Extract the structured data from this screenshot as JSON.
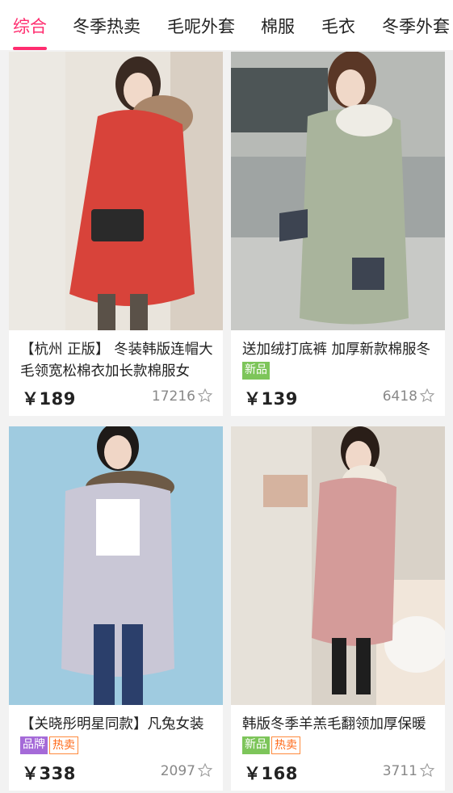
{
  "tabs": [
    {
      "label": "综合",
      "active": true
    },
    {
      "label": "冬季热卖",
      "active": false
    },
    {
      "label": "毛呢外套",
      "active": false
    },
    {
      "label": "棉服",
      "active": false
    },
    {
      "label": "毛衣",
      "active": false
    },
    {
      "label": "冬季外套",
      "active": false
    }
  ],
  "products": [
    {
      "title": "【杭州 正版】 冬装韩版连帽大毛领宽松棉衣加长款棉服女",
      "tags": [],
      "price": "￥189",
      "sales": "17216",
      "photo_colors": {
        "bg": "#e9e4dc",
        "coat": "#d8433a",
        "accent": "#a9866a"
      }
    },
    {
      "title": "送加绒打底裤 加厚新款棉服冬",
      "tags": [
        "新品"
      ],
      "price": "￥139",
      "sales": "6418",
      "photo_colors": {
        "bg": "#9fa4a3",
        "coat": "#a9b49c",
        "accent": "#3d4451"
      }
    },
    {
      "title": "【关晓彤明星同款】凡兔女装",
      "tags": [
        "品牌",
        "热卖"
      ],
      "price": "￥338",
      "sales": "2097",
      "photo_colors": {
        "bg": "#9fcbe0",
        "coat": "#c9c7d6",
        "accent": "#6d5a46"
      }
    },
    {
      "title": "韩版冬季羊羔毛翻领加厚保暖",
      "tags": [
        "新品",
        "热卖"
      ],
      "price": "￥168",
      "sales": "3711",
      "photo_colors": {
        "bg": "#d9d2c8",
        "coat": "#d49b99",
        "accent": "#f1e6da"
      }
    }
  ],
  "colors": {
    "accent": "#ff2d6f",
    "tag_new": "#7dc55a",
    "tag_hot": "#ff6a1a",
    "tag_brand": "#a56ad8"
  }
}
